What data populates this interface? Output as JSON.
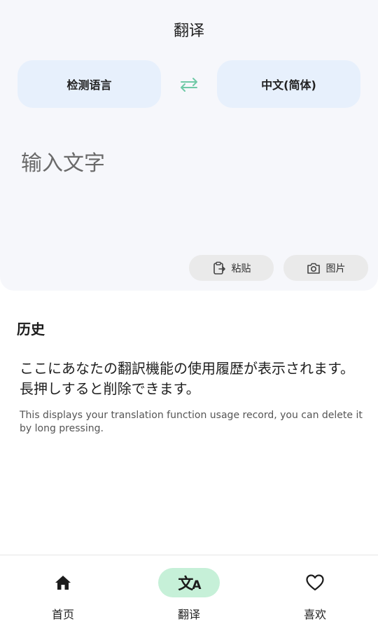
{
  "header": {
    "title": "翻译"
  },
  "languages": {
    "source": "检测语言",
    "target": "中文(简体)",
    "swap_icon": "swap-arrows-icon",
    "swap_color": "#6fc9a6"
  },
  "input": {
    "placeholder": "输入文字"
  },
  "actions": {
    "paste_label": "粘贴",
    "paste_icon": "clipboard-icon",
    "image_label": "图片",
    "image_icon": "camera-icon"
  },
  "history": {
    "heading": "历史",
    "empty_main": "ここにあなたの翻訳機能の使用履歴が表示されます。長押しすると削除できます。",
    "empty_sub": "This displays your translation function usage record, you can delete it by long pressing."
  },
  "nav": {
    "items": [
      {
        "label": "首页",
        "icon": "home-icon",
        "active": false
      },
      {
        "label": "翻译",
        "icon": "translate-icon",
        "active": true
      },
      {
        "label": "喜欢",
        "icon": "heart-icon",
        "active": false
      }
    ],
    "active_color": "#c6f0d8"
  }
}
